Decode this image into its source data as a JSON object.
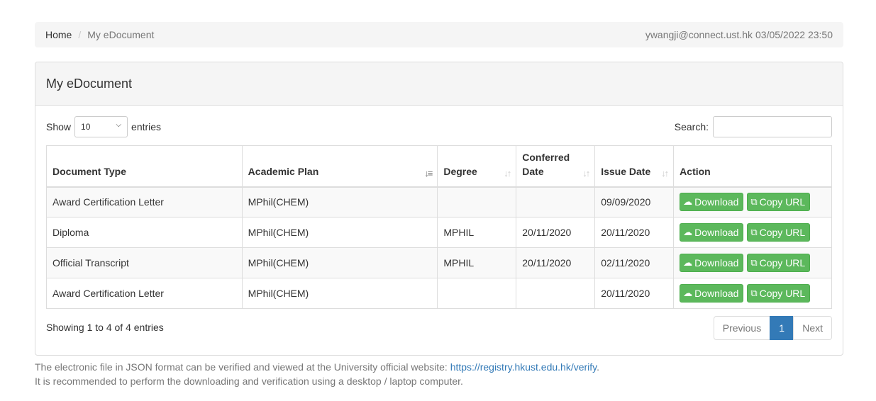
{
  "breadcrumb": {
    "home": "Home",
    "separator": "/",
    "current": "My eDocument"
  },
  "user": {
    "email": "ywangji@connect.ust.hk",
    "datetime": "03/05/2022 23:50"
  },
  "panel": {
    "title": "My eDocument"
  },
  "length_control": {
    "show_label": "Show",
    "selected": "10",
    "entries_label": "entries"
  },
  "search": {
    "label": "Search:",
    "value": ""
  },
  "table": {
    "columns": [
      "Document Type",
      "Academic Plan",
      "Degree",
      "Conferred Date",
      "Issue Date",
      "Action"
    ],
    "conferred_line1": "Conferred",
    "conferred_line2": "Date",
    "rows": [
      {
        "doc_type": "Award Certification Letter",
        "plan": "MPhil(CHEM)",
        "degree": "",
        "conferred": "",
        "issue": "09/09/2020"
      },
      {
        "doc_type": "Diploma",
        "plan": "MPhil(CHEM)",
        "degree": "MPHIL",
        "conferred": "20/11/2020",
        "issue": "20/11/2020"
      },
      {
        "doc_type": "Official Transcript",
        "plan": "MPhil(CHEM)",
        "degree": "MPHIL",
        "conferred": "20/11/2020",
        "issue": "02/11/2020"
      },
      {
        "doc_type": "Award Certification Letter",
        "plan": "MPhil(CHEM)",
        "degree": "",
        "conferred": "",
        "issue": "20/11/2020"
      }
    ],
    "download_label": "Download",
    "copy_label": "Copy URL",
    "download_icon": "cloud-download-icon",
    "copy_icon": "copy-icon",
    "sorted_column": "Academic Plan"
  },
  "info": {
    "text": "Showing 1 to 4 of 4 entries"
  },
  "pagination": {
    "previous": "Previous",
    "current": "1",
    "next": "Next"
  },
  "footnote": {
    "line1_prefix": "The electronic file in JSON format can be verified and viewed at the University official website: ",
    "link": "https://registry.hkust.edu.hk/verify",
    "line1_suffix": ".",
    "line2": "It is recommended to perform the downloading and verification using a desktop / laptop computer."
  },
  "colors": {
    "button_green": "#5cb85c",
    "pager_active": "#337ab7",
    "link_blue": "#337ab7"
  }
}
